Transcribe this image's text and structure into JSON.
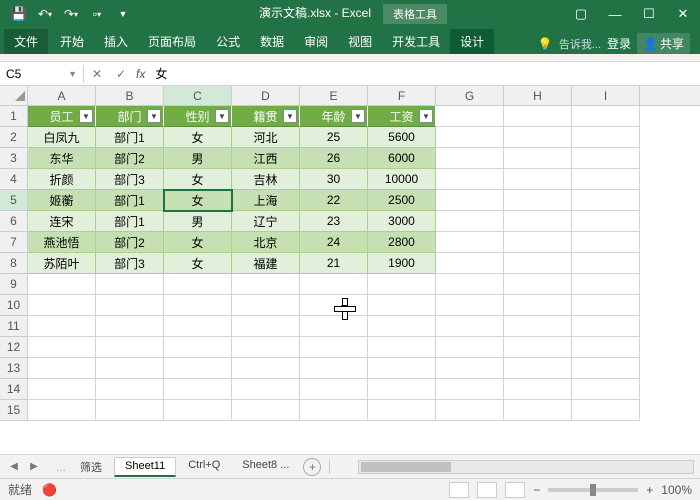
{
  "title": {
    "filename": "演示文稿.xlsx - Excel",
    "tool_tab": "表格工具"
  },
  "qat": {
    "save": "💾"
  },
  "ribbon": {
    "file": "文件",
    "tabs": [
      "开始",
      "插入",
      "页面布局",
      "公式",
      "数据",
      "审阅",
      "视图",
      "开发工具",
      "设计"
    ],
    "active": "设计",
    "tell": "告诉我...",
    "login": "登录",
    "share": "共享"
  },
  "namebox": {
    "ref": "C5"
  },
  "formula": {
    "value": "女"
  },
  "columns": [
    "A",
    "B",
    "C",
    "D",
    "E",
    "F",
    "G",
    "H",
    "I"
  ],
  "colwidths": {
    "A": 68,
    "B": 68,
    "C": 68,
    "D": 68,
    "E": 68,
    "F": 68,
    "G": 68,
    "H": 68,
    "I": 68
  },
  "active_cell": {
    "row": 5,
    "col": "C"
  },
  "table": {
    "headers": [
      "员工",
      "部门",
      "性别",
      "籍贯",
      "年龄",
      "工资"
    ],
    "rows": [
      [
        "白凤九",
        "部门1",
        "女",
        "河北",
        "25",
        "5600"
      ],
      [
        "东华",
        "部门2",
        "男",
        "江西",
        "26",
        "6000"
      ],
      [
        "折颜",
        "部门3",
        "女",
        "吉林",
        "30",
        "10000"
      ],
      [
        "姬蘅",
        "部门1",
        "女",
        "上海",
        "22",
        "2500"
      ],
      [
        "连宋",
        "部门1",
        "男",
        "辽宁",
        "23",
        "3000"
      ],
      [
        "燕池悟",
        "部门2",
        "女",
        "北京",
        "24",
        "2800"
      ],
      [
        "苏陌叶",
        "部门3",
        "女",
        "福建",
        "21",
        "1900"
      ]
    ]
  },
  "row_count": 15,
  "sheets": {
    "tabs": [
      "筛选",
      "Sheet11",
      "Ctrl+Q",
      "Sheet8 ..."
    ],
    "active": "Sheet11"
  },
  "status": {
    "mode": "就绪",
    "zoom": "100%",
    "rec": "🔴"
  },
  "icons": {
    "min": "—",
    "max": "☐",
    "close": "✕",
    "ribmin": "▢",
    "undo": "↶",
    "redo": "↷",
    "new": "▫",
    "dd": "▾",
    "person": "👤"
  }
}
